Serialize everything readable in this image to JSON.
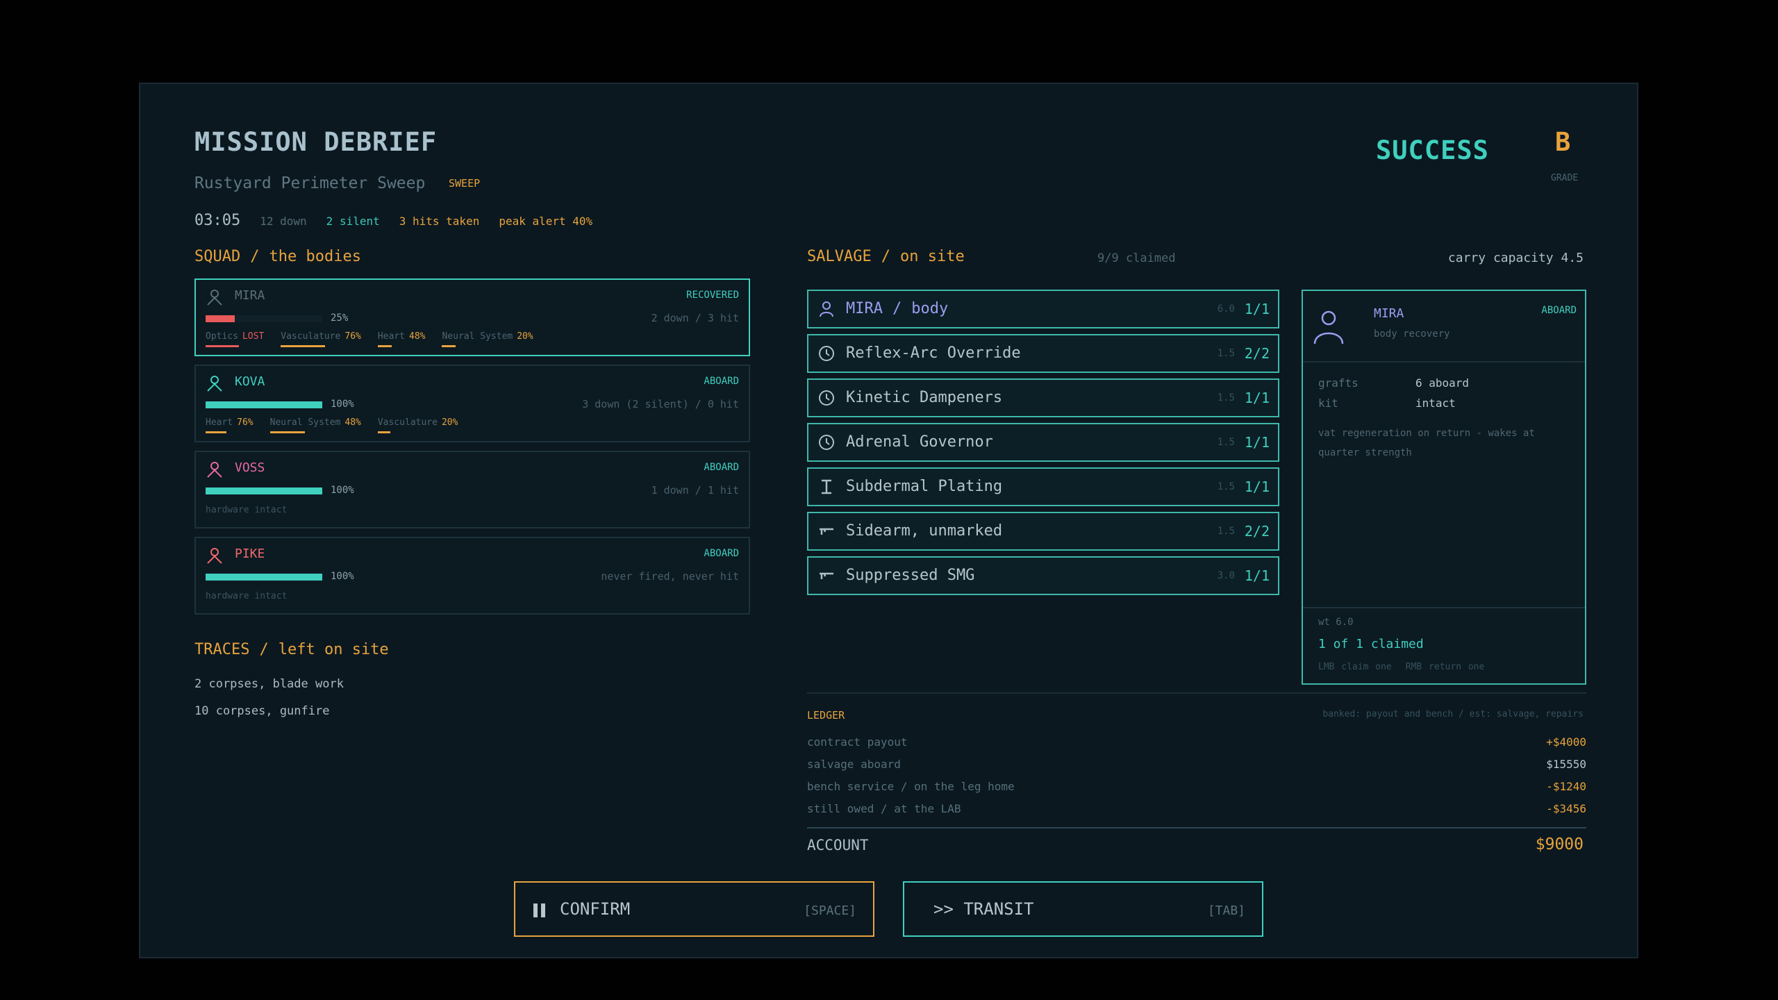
{
  "header": {
    "title": "MISSION DEBRIEF",
    "mission_name": "Rustyard Perimeter Sweep",
    "mission_tag": "SWEEP",
    "time": "03:05",
    "stats": {
      "down": "12 down",
      "silent": "2 silent",
      "hits": "3 hits taken",
      "alert": "peak alert 40%"
    },
    "outcome": "SUCCESS",
    "grade": "B",
    "grade_label": "GRADE"
  },
  "squad": {
    "heading": "SQUAD",
    "subheading": "the bodies",
    "members": [
      {
        "name": "MIRA",
        "status": "RECOVERED",
        "health_pct": "25%",
        "health": 0.25,
        "note": "2 down  /  3 hit",
        "organs": [
          {
            "name": "Optics",
            "value": "LOST"
          },
          {
            "name": "Vasculature",
            "value": "76%"
          },
          {
            "name": "Heart",
            "value": "48%"
          },
          {
            "name": "Neural System",
            "value": "20%"
          }
        ]
      },
      {
        "name": "KOVA",
        "status": "ABOARD",
        "health_pct": "100%",
        "health": 1.0,
        "note": "3 down (2 silent)  /  0 hit",
        "organs": [
          {
            "name": "Heart",
            "value": "76%"
          },
          {
            "name": "Neural System",
            "value": "48%"
          },
          {
            "name": "Vasculature",
            "value": "20%"
          }
        ]
      },
      {
        "name": "VOSS",
        "status": "ABOARD",
        "health_pct": "100%",
        "health": 1.0,
        "note": "1 down  /  1 hit",
        "hardware": "hardware intact"
      },
      {
        "name": "PIKE",
        "status": "ABOARD",
        "health_pct": "100%",
        "health": 1.0,
        "note": "never fired, never hit",
        "hardware": "hardware intact"
      }
    ]
  },
  "traces": {
    "heading": "TRACES",
    "subheading": "left on site",
    "items": [
      "2 corpses, blade work",
      "10 corpses, gunfire"
    ]
  },
  "salvage": {
    "heading": "SALVAGE",
    "subheading": "on site",
    "claimed": "9/9 claimed",
    "capacity": "carry capacity 4.5",
    "items": [
      {
        "name": "MIRA",
        "sub": "body",
        "weight": "6.0",
        "count": "1/1",
        "icon": "person-icon"
      },
      {
        "name": "Reflex-Arc Override",
        "weight": "1.5",
        "count": "2/2",
        "icon": "clock-icon"
      },
      {
        "name": "Kinetic Dampeners",
        "weight": "1.5",
        "count": "1/1",
        "icon": "clock-icon"
      },
      {
        "name": "Adrenal Governor",
        "weight": "1.5",
        "count": "1/1",
        "icon": "clock-icon"
      },
      {
        "name": "Subdermal Plating",
        "weight": "1.5",
        "count": "1/1",
        "icon": "plating-icon"
      },
      {
        "name": "Sidearm, unmarked",
        "weight": "1.5",
        "count": "2/2",
        "icon": "gun-icon"
      },
      {
        "name": "Suppressed SMG",
        "weight": "3.0",
        "count": "1/1",
        "icon": "gun-icon"
      }
    ]
  },
  "detail": {
    "name": "MIRA",
    "sub": "body recovery",
    "status": "ABOARD",
    "grafts_label": "grafts",
    "grafts_value": "6 aboard",
    "kit_label": "kit",
    "kit_value": "intact",
    "note": "vat regeneration on return - wakes at quarter strength",
    "weight": "wt 6.0",
    "claimed": "1 of 1 claimed",
    "hint_lmb": "LMB claim one",
    "hint_rmb": "RMB return one"
  },
  "ledger": {
    "title": "LEDGER",
    "legend": "banked: payout and bench  /  est: salvage, repairs",
    "rows": [
      {
        "label": "contract payout",
        "value": "+$4000",
        "color": "#e8a33c"
      },
      {
        "label": "salvage aboard",
        "value": "$15550",
        "color": "#b9c6cc"
      },
      {
        "label": "bench service  /  on the leg home",
        "value": "-$1240",
        "color": "#e8a33c"
      },
      {
        "label": "still owed  /  at the LAB",
        "value": "-$3456",
        "color": "#e8a33c"
      }
    ],
    "account_label": "ACCOUNT",
    "account_value": "$9000"
  },
  "buttons": {
    "confirm_label": "CONFIRM",
    "confirm_key": "[SPACE]",
    "transit_label": ">> TRANSIT",
    "transit_key": "[TAB]"
  },
  "colors": {
    "accent_teal": "#3fd0bf",
    "accent_amber": "#e8a33c",
    "danger_red": "#e85a5a",
    "body_violet": "#9d9cf0"
  }
}
